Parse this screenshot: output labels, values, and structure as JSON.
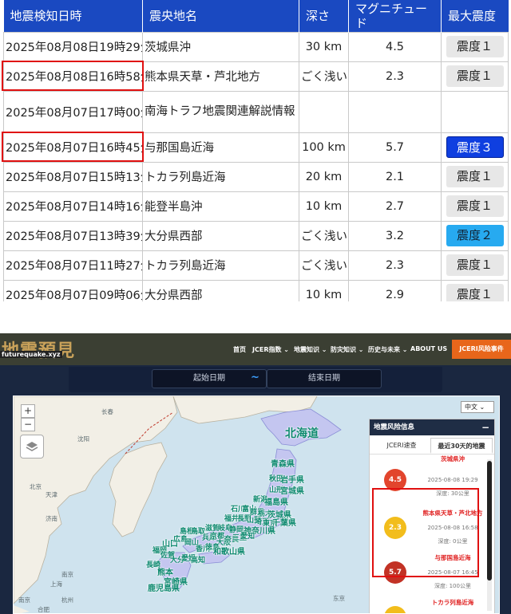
{
  "table": {
    "headers": {
      "datetime": "地震検知日時",
      "epicenter": "震央地名",
      "depth": "深さ",
      "magnitude": "マグニチュード",
      "max_intensity": "最大震度"
    },
    "rows": [
      {
        "datetime": "2025年08月08日19時29分",
        "epicenter": "茨城県沖",
        "depth": "30 km",
        "magnitude": "4.5",
        "intensity": "震度１",
        "level": "1"
      },
      {
        "datetime": "2025年08月08日16時58分",
        "epicenter": "熊本県天草・芦北地方",
        "depth": "ごく浅い",
        "magnitude": "2.3",
        "intensity": "震度１",
        "level": "1",
        "highlighted": true
      },
      {
        "datetime": "2025年08月07日17時00分",
        "epicenter": "南海トラフ地震関連解説情報",
        "depth": "",
        "magnitude": "",
        "intensity": "",
        "level": ""
      },
      {
        "datetime": "2025年08月07日16時45分",
        "epicenter": "与那国島近海",
        "depth": "100 km",
        "magnitude": "5.7",
        "intensity": "震度３",
        "level": "3",
        "highlighted": true
      },
      {
        "datetime": "2025年08月07日15時13分",
        "epicenter": "トカラ列島近海",
        "depth": "20 km",
        "magnitude": "2.1",
        "intensity": "震度１",
        "level": "1"
      },
      {
        "datetime": "2025年08月07日14時16分",
        "epicenter": "能登半島沖",
        "depth": "10 km",
        "magnitude": "2.7",
        "intensity": "震度１",
        "level": "1"
      },
      {
        "datetime": "2025年08月07日13時39分",
        "epicenter": "大分県西部",
        "depth": "ごく浅い",
        "magnitude": "3.2",
        "intensity": "震度２",
        "level": "2"
      },
      {
        "datetime": "2025年08月07日11時27分",
        "epicenter": "トカラ列島近海",
        "depth": "ごく浅い",
        "magnitude": "2.3",
        "intensity": "震度１",
        "level": "1"
      },
      {
        "datetime": "2025年08月07日09時06分",
        "epicenter": "大分県西部",
        "depth": "10 km",
        "magnitude": "2.9",
        "intensity": "震度１",
        "level": "1"
      }
    ]
  },
  "site": {
    "logo_text": "地震預見",
    "logo_subtitle": "futurequake.xyz",
    "nav": [
      {
        "label": "首页"
      },
      {
        "label": "JCER指数 ⌄"
      },
      {
        "label": "地震知识 ⌄"
      },
      {
        "label": "防灾知识 ⌄"
      },
      {
        "label": "历史与未来 ⌄"
      },
      {
        "label": "ABOUT US"
      }
    ],
    "cta_label": "JCERI风险事件",
    "start_date_placeholder": "起始日期",
    "date_separator": "~",
    "end_date_placeholder": "结束日期"
  },
  "map": {
    "zoom_in": "+",
    "zoom_out": "−",
    "language": "中文 ⌄",
    "region_labels": [
      "北海道",
      "青森県",
      "秋田",
      "岩手県",
      "山形",
      "宮城県",
      "新潟",
      "福島県",
      "石川",
      "富山",
      "群馬",
      "栃木",
      "茨城県",
      "福井",
      "長野",
      "山梨",
      "埼玉",
      "東京",
      "千葉県",
      "滋賀",
      "岐阜",
      "静岡",
      "神奈川県",
      "島根",
      "鳥取",
      "兵庫",
      "京都",
      "大阪",
      "奈良",
      "三重",
      "愛知",
      "山口",
      "広島",
      "岡山",
      "香川",
      "徳島",
      "和歌山県",
      "福岡",
      "佐賀",
      "大分",
      "愛媛",
      "高知",
      "長崎",
      "熊本",
      "宮崎県",
      "鹿児島県"
    ],
    "cities": [
      "长春",
      "沈阳",
      "天津",
      "北京",
      "济南",
      "南京",
      "上海",
      "杭州",
      "合肥",
      "南京",
      "东京"
    ]
  },
  "risk_panel": {
    "title": "地震风险信息",
    "minimize": "−",
    "tabs": [
      "JCERI速查",
      "最近30天的地震"
    ],
    "active_tab": 1,
    "items": [
      {
        "place": "茨城県沖",
        "time": "2025-08-08 19:29",
        "depth": "深度: 30公里",
        "magnitude": "4.5",
        "color": "#e2452d"
      },
      {
        "place": "熊本県天草・芦北地方",
        "time": "2025-08-08 16:58",
        "depth": "深度: 0公里",
        "magnitude": "2.3",
        "color": "#f2bd1c"
      },
      {
        "place": "与那国島近海",
        "time": "2025-08-07 16:45",
        "depth": "深度: 100公里",
        "magnitude": "5.7",
        "color": "#c23225"
      },
      {
        "place": "トカラ列島近海",
        "time": "",
        "depth": "",
        "magnitude": "",
        "color": "#f2bd1c"
      }
    ]
  },
  "colors": {
    "table_header": "#1a49c1",
    "highlight": "#e01010",
    "intensity3": "#0f3fe0",
    "intensity2": "#27aaf0",
    "nav_cta": "#e8661b"
  }
}
